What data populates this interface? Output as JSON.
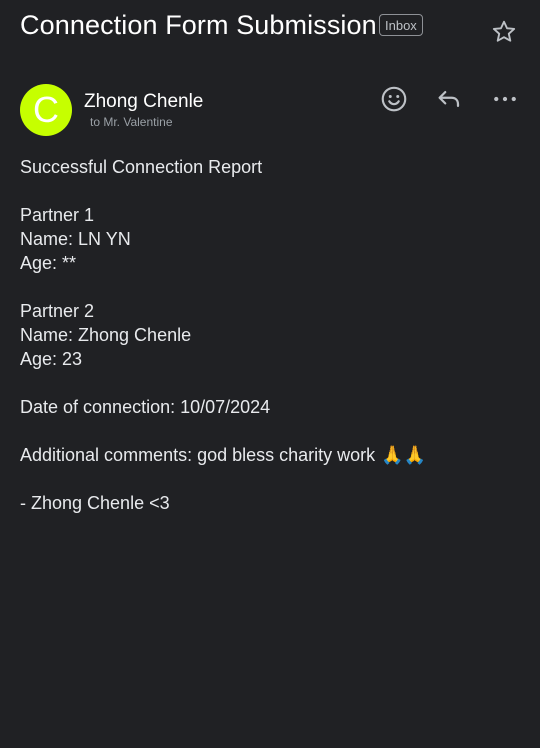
{
  "email": {
    "subject": "Connection Form Submission",
    "label": "Inbox",
    "sender_name": "Zhong Chenle",
    "sender_initial": "C",
    "recipient": "to Mr. Valentine",
    "avatar_color": "#c6ff00",
    "body": {
      "heading": "Successful Connection Report",
      "partner1_title": "Partner 1",
      "partner1_name": "Name: LN YN",
      "partner1_age": "Age: **",
      "partner2_title": "Partner 2",
      "partner2_name": "Name: Zhong Chenle",
      "partner2_age": "Age: 23",
      "date": "Date of connection: 10/07/2024",
      "comments": "Additional comments: god bless charity work",
      "comments_emoji": "🙏🙏",
      "signature": "- Zhong Chenle <3"
    }
  },
  "icons": {
    "star": "star-icon",
    "emoji": "smiley-icon",
    "reply": "reply-icon",
    "more": "more-icon"
  }
}
